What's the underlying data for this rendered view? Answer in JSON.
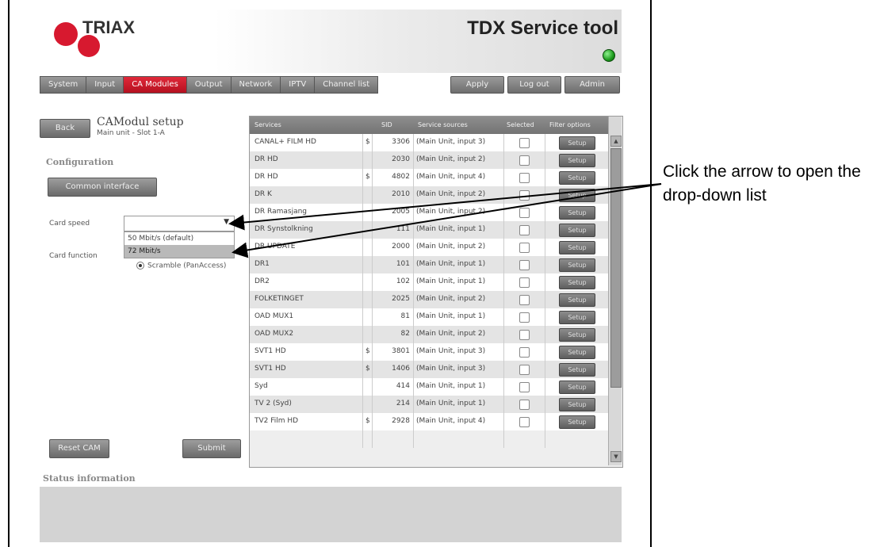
{
  "header": {
    "logo_text": "TRIAX",
    "app_title": "TDX Service tool",
    "status_led_color": "#1c9a1c"
  },
  "nav": {
    "tabs": [
      {
        "label": "System",
        "active": false
      },
      {
        "label": "Input",
        "active": false
      },
      {
        "label": "CA Modules",
        "active": true
      },
      {
        "label": "Output",
        "active": false
      },
      {
        "label": "Network",
        "active": false
      },
      {
        "label": "IPTV",
        "active": false
      },
      {
        "label": "Channel list",
        "active": false
      }
    ],
    "apply_label": "Apply",
    "logout_label": "Log out",
    "admin_label": "Admin"
  },
  "left": {
    "back_label": "Back",
    "setup_title": "CAModul setup",
    "setup_subtitle": "Main unit - Slot 1-A",
    "config_title": "Configuration",
    "common_interface_label": "Common interface",
    "card_speed_label": "Card speed",
    "card_speed_value": "",
    "card_speed_options": [
      "50 Mbit/s (default)",
      "72 Mbit/s"
    ],
    "card_speed_highlighted": "72 Mbit/s",
    "card_function_label": "Card function",
    "card_function_option": "Scramble (PanAccess)",
    "reset_cam_label": "Reset CAM",
    "submit_label": "Submit",
    "status_title": "Status information"
  },
  "table": {
    "headers": {
      "services": "Services",
      "sid": "SID",
      "source": "Service sources",
      "selected": "Selected",
      "filter": "Filter options"
    },
    "setup_label": "Setup",
    "rows": [
      {
        "service": "CANAL+ FILM HD",
        "enc": "$",
        "sid": "3306",
        "source": "(Main Unit, input 3)"
      },
      {
        "service": "DR HD",
        "enc": "",
        "sid": "2030",
        "source": "(Main Unit, input 2)"
      },
      {
        "service": "DR HD",
        "enc": "$",
        "sid": "4802",
        "source": "(Main Unit, input 4)"
      },
      {
        "service": "DR K",
        "enc": "",
        "sid": "2010",
        "source": "(Main Unit, input 2)"
      },
      {
        "service": "DR Ramasjang",
        "enc": "",
        "sid": "2005",
        "source": "(Main Unit, input 2)"
      },
      {
        "service": "DR Synstolkning",
        "enc": "",
        "sid": "111",
        "source": "(Main Unit, input 1)"
      },
      {
        "service": "DR UPDATE",
        "enc": "",
        "sid": "2000",
        "source": "(Main Unit, input 2)"
      },
      {
        "service": "DR1",
        "enc": "",
        "sid": "101",
        "source": "(Main Unit, input 1)"
      },
      {
        "service": "DR2",
        "enc": "",
        "sid": "102",
        "source": "(Main Unit, input 1)"
      },
      {
        "service": "FOLKETINGET",
        "enc": "",
        "sid": "2025",
        "source": "(Main Unit, input 2)"
      },
      {
        "service": "OAD MUX1",
        "enc": "",
        "sid": "81",
        "source": "(Main Unit, input 1)"
      },
      {
        "service": "OAD MUX2",
        "enc": "",
        "sid": "82",
        "source": "(Main Unit, input 2)"
      },
      {
        "service": "SVT1 HD",
        "enc": "$",
        "sid": "3801",
        "source": "(Main Unit, input 3)"
      },
      {
        "service": "SVT1 HD",
        "enc": "$",
        "sid": "1406",
        "source": "(Main Unit, input 3)"
      },
      {
        "service": "Syd",
        "enc": "",
        "sid": "414",
        "source": "(Main Unit, input 1)"
      },
      {
        "service": "TV 2 (Syd)",
        "enc": "",
        "sid": "214",
        "source": "(Main Unit, input 1)"
      },
      {
        "service": "TV2 Film HD",
        "enc": "$",
        "sid": "2928",
        "source": "(Main Unit, input 4)"
      }
    ]
  },
  "callout": {
    "text": "Click the arrow to open the drop-down list"
  }
}
